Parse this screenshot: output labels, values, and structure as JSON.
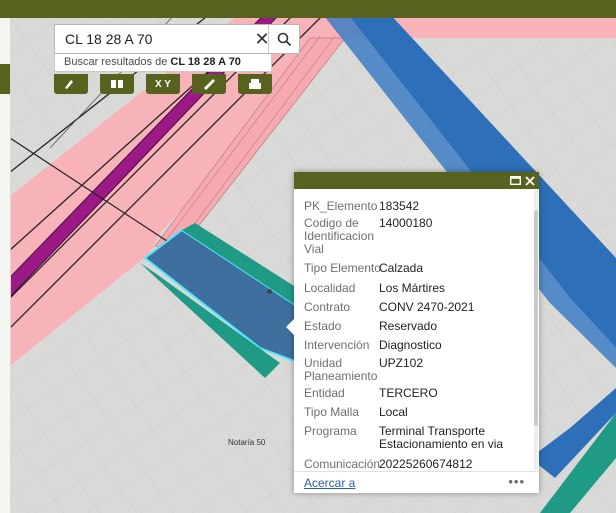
{
  "search": {
    "value": "CL 18 28 A 70",
    "clear_glyph": "✕",
    "suggestion_prefix": "Buscar resultados de",
    "suggestion_term": "CL 18 28 A 70"
  },
  "toolbar": {
    "xy_label": "X Y",
    "tools": [
      "draw-tool-icon",
      "basemap-gallery-icon",
      "coordinate-xy-icon",
      "measure-ruler-icon",
      "print-icon"
    ]
  },
  "map": {
    "label": "Notaría 50"
  },
  "popup": {
    "fields": [
      {
        "label": "PK_Elemento",
        "value": "183542"
      },
      {
        "label": "Codigo de Identificacion Vial",
        "value": "14000180"
      },
      {
        "label": "Tipo Elemento",
        "value": "Calzada"
      },
      {
        "label": "Localidad",
        "value": "Los Mártires"
      },
      {
        "label": "Contrato",
        "value": "CONV 2470-2021"
      },
      {
        "label": "Estado",
        "value": "Reservado"
      },
      {
        "label": "Intervención",
        "value": "Diagnostico"
      },
      {
        "label": "Unidad Planeamiento",
        "value": "UPZ102"
      },
      {
        "label": "Entidad",
        "value": "TERCERO"
      },
      {
        "label": "Tipo Malla",
        "value": "Local"
      },
      {
        "label": "Programa",
        "value": "Terminal Transporte Estacionamiento en via"
      },
      {
        "label": "Comunicación",
        "value": "20225260674812"
      }
    ],
    "zoom_link": "Acercar a",
    "more_glyph": "•••"
  },
  "colors": {
    "theme": "#58621f",
    "parcel_pink": "#f8b3b8",
    "road_blue": "#2d6fb8",
    "road_highlight": "#3e6f9e",
    "road_teal": "#1f9a84",
    "median_purple": "#9b1a86"
  }
}
